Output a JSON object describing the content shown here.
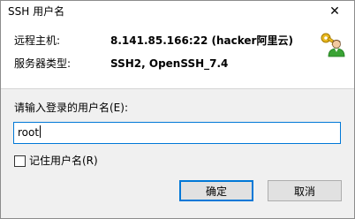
{
  "window": {
    "title": "SSH 用户名",
    "close_glyph": "✕"
  },
  "info": {
    "host_label": "远程主机:",
    "host_value": "8.141.85.166:22 (hacker阿里云)",
    "server_type_label": "服务器类型:",
    "server_type_value": "SSH2, OpenSSH_7.4",
    "icon": "user-key-icon"
  },
  "form": {
    "prompt": "请输入登录的用户名(E):",
    "username_value": "root",
    "remember_label": "记住用户名(R)",
    "remember_checked": false
  },
  "buttons": {
    "ok_label": "确定",
    "cancel_label": "取消"
  },
  "colors": {
    "accent": "#0078d7",
    "lower_background": "#f0f0f0",
    "button_background": "#e1e1e1"
  }
}
